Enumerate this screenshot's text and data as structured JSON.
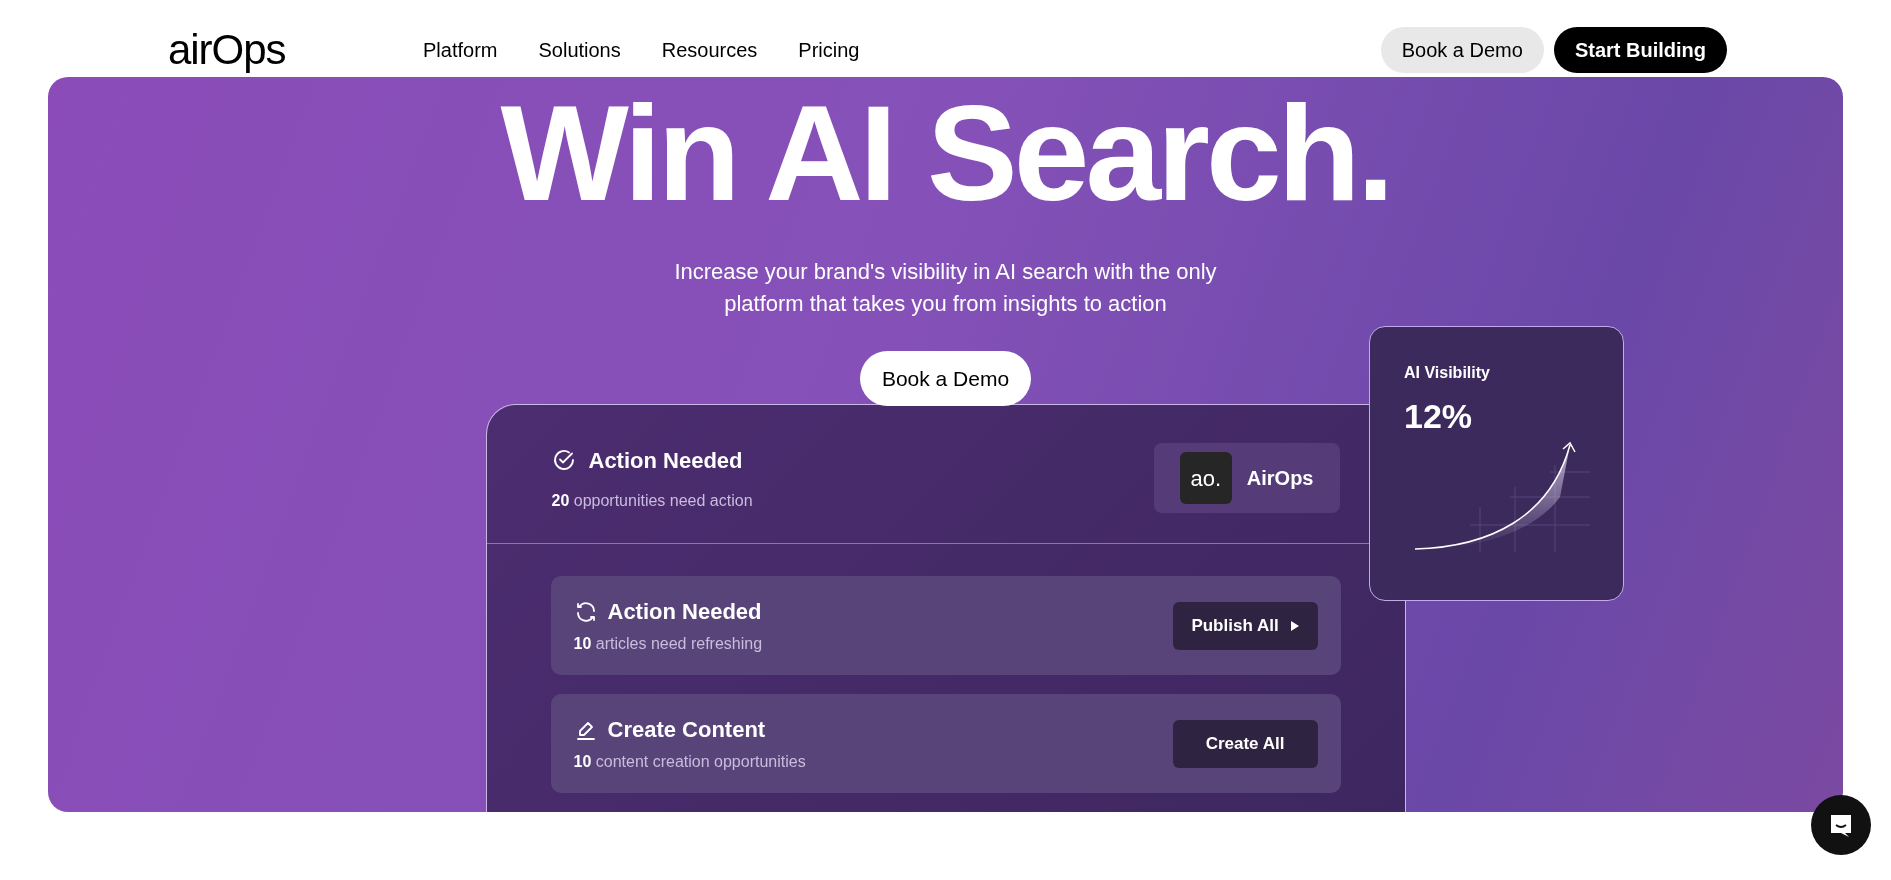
{
  "nav": {
    "logo": "airOps",
    "links": [
      "Platform",
      "Solutions",
      "Resources",
      "Pricing"
    ],
    "buttons": [
      {
        "label": "Book a Demo",
        "kind": "secondary"
      },
      {
        "label": "Start Building",
        "kind": "primary"
      }
    ]
  },
  "hero": {
    "title": "Win AI Search.",
    "subtitle": "Increase your brand's visibility in AI search with the only platform that takes you from insights to action",
    "cta": "Book a Demo"
  },
  "panel": {
    "header": {
      "title": "Action Needed",
      "count": "20",
      "text": "opportunities need action",
      "brand_mark": "ao.",
      "brand": "AirOps"
    },
    "rows": [
      {
        "kind": "refresh",
        "title": "Action Needed",
        "count": "10",
        "text": "articles need refreshing",
        "button": "Publish All",
        "arrow": true
      },
      {
        "kind": "create",
        "title": "Create Content",
        "count": "10",
        "text": "content creation opportunities",
        "button": "Create All",
        "arrow": false
      }
    ]
  },
  "visibility_card": {
    "label": "AI Visibility",
    "value": "12%"
  }
}
